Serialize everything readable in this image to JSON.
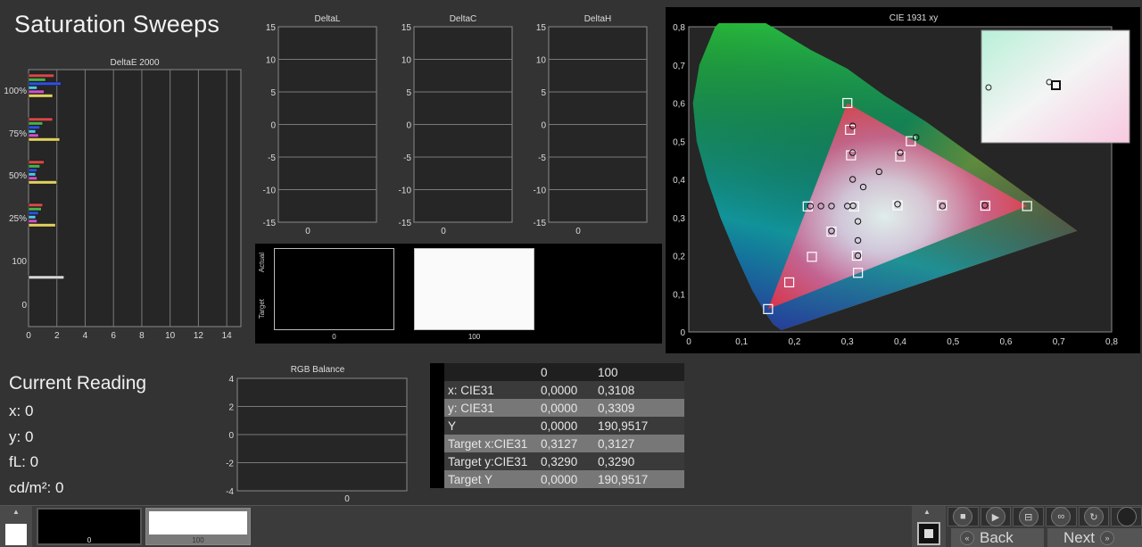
{
  "page": {
    "title": "Saturation Sweeps"
  },
  "deltae": {
    "title": "DeltaE 2000",
    "xticks": [
      "0",
      "2",
      "4",
      "6",
      "8",
      "10",
      "12",
      "14"
    ],
    "ylabels": [
      "100%",
      "75%",
      "50%",
      "25%",
      "100",
      "0"
    ]
  },
  "delta_charts": [
    {
      "title": "DeltaL",
      "xlabel": "0"
    },
    {
      "title": "DeltaC",
      "xlabel": "0"
    },
    {
      "title": "DeltaH",
      "xlabel": "0"
    }
  ],
  "delta_yticks": [
    "15",
    "10",
    "5",
    "0",
    "-5",
    "-10",
    "-15"
  ],
  "swatch_panel": {
    "actual_label": "Actual",
    "target_label": "Target",
    "swatches": [
      {
        "label": "0",
        "color": "#000000"
      },
      {
        "label": "100",
        "color": "#fafafa"
      }
    ]
  },
  "cie": {
    "title": "CIE 1931 xy",
    "xticks": [
      "0",
      "0,1",
      "0,2",
      "0,3",
      "0,4",
      "0,5",
      "0,6",
      "0,7",
      "0,8"
    ],
    "yticks": [
      "0",
      "0,1",
      "0,2",
      "0,3",
      "0,4",
      "0,5",
      "0,6",
      "0,7",
      "0,8"
    ]
  },
  "rgb_balance": {
    "title": "RGB Balance",
    "yticks": [
      "4",
      "2",
      "0",
      "-2",
      "-4"
    ],
    "xlabel": "0"
  },
  "current_reading": {
    "title": "Current Reading",
    "x": "x: 0",
    "y": "y: 0",
    "fl": "fL: 0",
    "cdm2": "cd/m²: 0"
  },
  "table": {
    "headers": [
      "",
      "0",
      "100"
    ],
    "rows": [
      [
        "x: CIE31",
        "0,0000",
        "0,3108"
      ],
      [
        "y: CIE31",
        "0,0000",
        "0,3309"
      ],
      [
        "Y",
        "0,0000",
        "190,9517"
      ],
      [
        "Target x:CIE31",
        "0,3127",
        "0,3127"
      ],
      [
        "Target y:CIE31",
        "0,3290",
        "0,3290"
      ],
      [
        "Target Y",
        "0,0000",
        "190,9517"
      ]
    ]
  },
  "bottom": {
    "patches": [
      {
        "label": "0",
        "color": "#000000"
      },
      {
        "label": "100",
        "color": "#ffffff"
      }
    ],
    "back_label": "Back",
    "next_label": "Next",
    "controls": [
      "stop-icon",
      "play-icon",
      "step-icon",
      "loop-icon",
      "refresh-icon"
    ]
  },
  "chart_data": [
    {
      "type": "bar",
      "title": "DeltaE 2000",
      "xlim": [
        0,
        15
      ],
      "orientation": "horizontal",
      "groups": [
        {
          "label": "100%",
          "values": [
            1.8,
            1.2,
            2.3,
            0.6,
            1.1,
            1.7
          ]
        },
        {
          "label": "75%",
          "values": [
            1.7,
            1.0,
            0.8,
            0.5,
            0.7,
            2.2
          ]
        },
        {
          "label": "50%",
          "values": [
            1.1,
            0.8,
            0.6,
            0.5,
            0.6,
            2.0
          ]
        },
        {
          "label": "25%",
          "values": [
            1.0,
            0.9,
            0.7,
            0.5,
            0.6,
            1.9
          ]
        },
        {
          "label": "100",
          "values": [
            2.5
          ]
        }
      ]
    },
    {
      "type": "scatter",
      "title": "CIE 1931 xy",
      "xlim": [
        0,
        0.8
      ],
      "ylim": [
        0,
        0.8
      ],
      "gamut": [
        [
          0.64,
          0.33
        ],
        [
          0.3,
          0.6
        ],
        [
          0.15,
          0.06
        ]
      ],
      "targets": [
        [
          0.64,
          0.33
        ],
        [
          0.561,
          0.331
        ],
        [
          0.479,
          0.332
        ],
        [
          0.395,
          0.332
        ],
        [
          0.3127,
          0.329
        ],
        [
          0.3,
          0.6
        ],
        [
          0.305,
          0.53
        ],
        [
          0.307,
          0.463
        ],
        [
          0.4,
          0.46
        ],
        [
          0.42,
          0.5
        ],
        [
          0.15,
          0.06
        ],
        [
          0.19,
          0.13
        ],
        [
          0.233,
          0.197
        ],
        [
          0.27,
          0.263
        ],
        [
          0.225,
          0.329
        ],
        [
          0.32,
          0.155
        ],
        [
          0.318,
          0.2
        ]
      ],
      "measured": [
        [
          0.3108,
          0.3309
        ],
        [
          0.3,
          0.33
        ],
        [
          0.27,
          0.33
        ],
        [
          0.25,
          0.33
        ],
        [
          0.23,
          0.33
        ],
        [
          0.31,
          0.54
        ],
        [
          0.31,
          0.47
        ],
        [
          0.31,
          0.4
        ],
        [
          0.33,
          0.38
        ],
        [
          0.36,
          0.42
        ],
        [
          0.4,
          0.47
        ],
        [
          0.43,
          0.51
        ],
        [
          0.32,
          0.29
        ],
        [
          0.32,
          0.24
        ],
        [
          0.32,
          0.2
        ],
        [
          0.395,
          0.335
        ],
        [
          0.48,
          0.33
        ],
        [
          0.56,
          0.332
        ],
        [
          0.27,
          0.265
        ]
      ]
    }
  ]
}
